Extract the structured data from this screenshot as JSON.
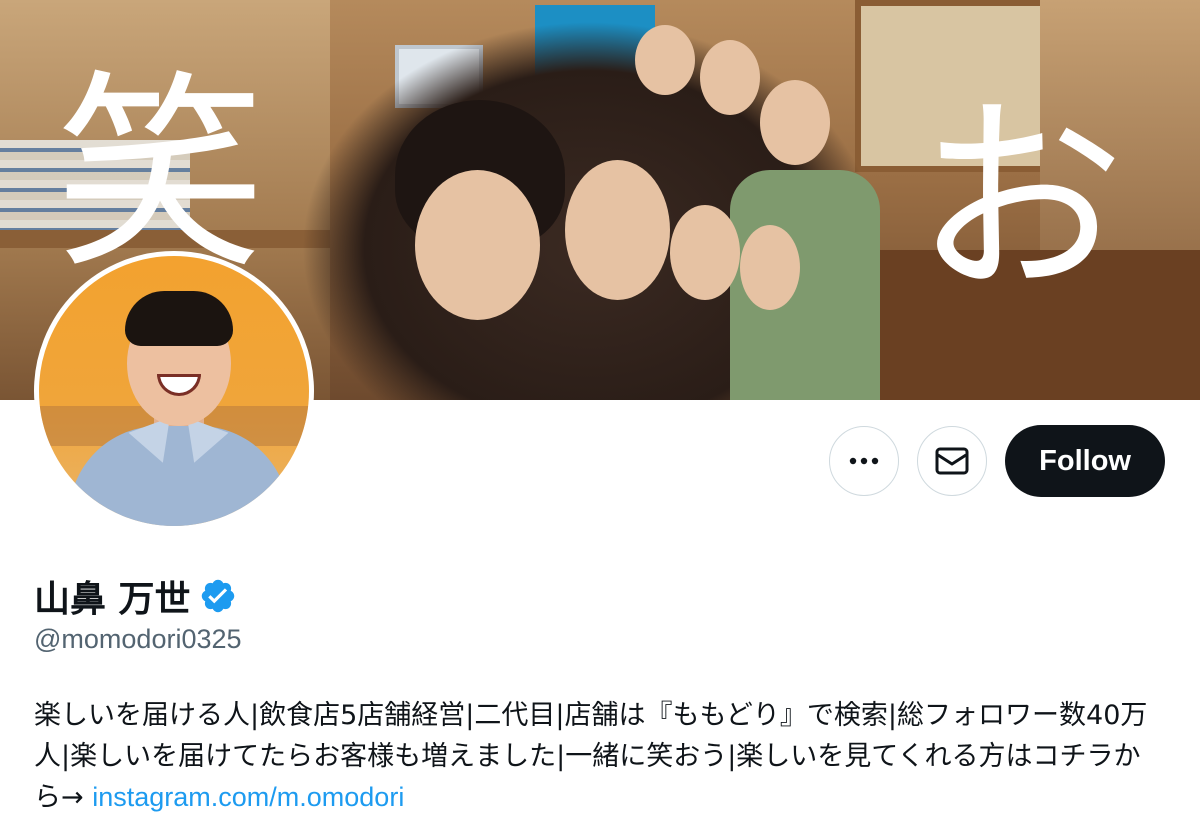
{
  "banner": {
    "overlay_left_char": "笑",
    "overlay_right_char": "お"
  },
  "profile": {
    "display_name": "山鼻 万世",
    "handle": "@momodori0325",
    "verified": true,
    "bio_text": "楽しいを届ける人|飲食店5店舗経営|二代目|店舗は『ももどり』で検索|総フォロワー数40万人|楽しいを届けてたらお客様も増えました|一緒に笑おう|楽しいを見てくれる方はコチラから→ ",
    "bio_link": "instagram.com/m.omodori"
  },
  "actions": {
    "more_icon": "more-horizontal-icon",
    "message_icon": "envelope-icon",
    "follow_label": "Follow"
  },
  "colors": {
    "follow_bg": "#0f1419",
    "link": "#1d9bf0",
    "verified": "#1d9bf0",
    "secondary_text": "#536471",
    "border": "#cfd9de"
  }
}
